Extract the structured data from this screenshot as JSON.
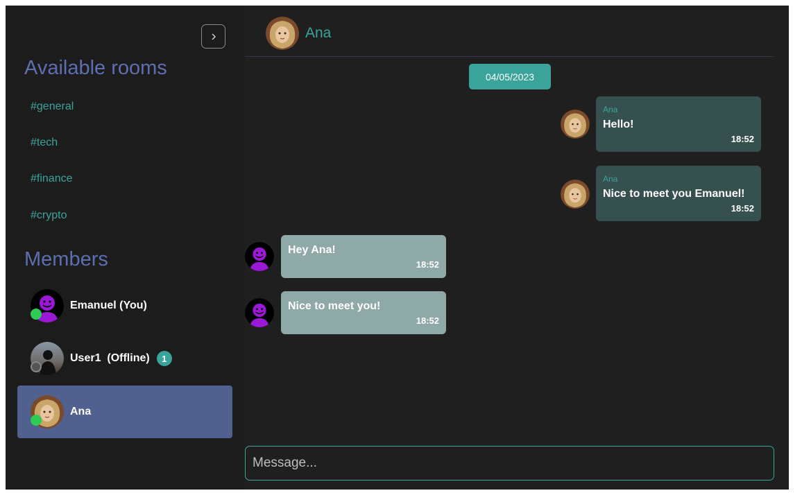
{
  "sidebar": {
    "toggle_icon": "chevron-right-icon",
    "rooms_title": "Available rooms",
    "rooms": [
      "#general",
      "#tech",
      "#finance",
      "#crypto"
    ],
    "members_title": "Members",
    "members": [
      {
        "name": "Emanuel (You)",
        "status": "online"
      },
      {
        "name": "User1  (Offline)",
        "status": "offline",
        "unread": "1"
      },
      {
        "name": "Ana",
        "status": "online",
        "active": true
      }
    ]
  },
  "chat": {
    "header_name": "Ana",
    "date": "04/05/2023",
    "messages": [
      {
        "direction": "incoming",
        "sender": "Ana",
        "text": "Hello!",
        "time": "18:52"
      },
      {
        "direction": "incoming",
        "sender": "Ana",
        "text": "Nice to meet you Emanuel!",
        "time": "18:52"
      },
      {
        "direction": "outgoing",
        "text": "Hey Ana!",
        "time": "18:52"
      },
      {
        "direction": "outgoing",
        "text": "Nice to meet you!",
        "time": "18:52"
      }
    ],
    "composer_placeholder": "Message..."
  },
  "colors": {
    "accent": "#3aa49b",
    "title": "#5d6fb0",
    "active_member": "#50608f",
    "incoming_bubble": "#365050",
    "outgoing_bubble": "#8fa8a8",
    "online": "#2ecc55"
  }
}
